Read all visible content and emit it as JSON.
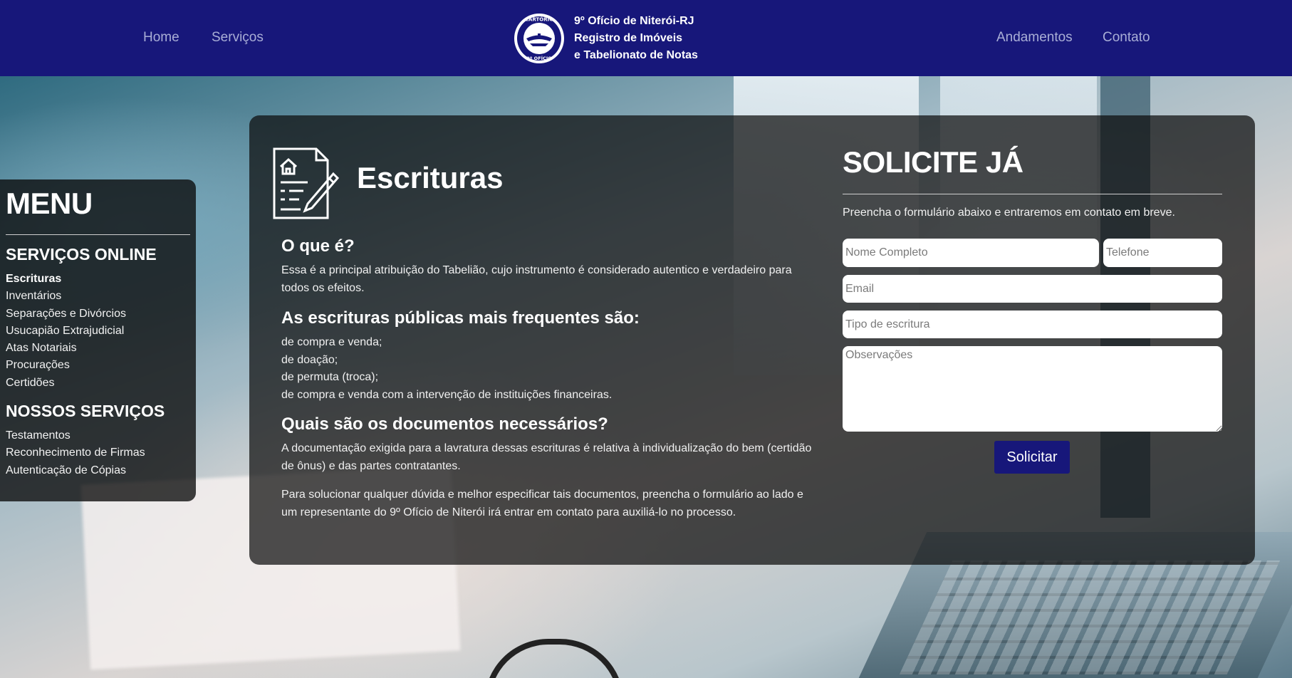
{
  "header": {
    "nav_left": [
      "Home",
      "Serviços"
    ],
    "nav_right": [
      "Andamentos",
      "Contato"
    ],
    "brand_lines": [
      "9º Ofício de Niterói-RJ",
      "Registro de Imóveis",
      "e Tabelionato de Notas"
    ],
    "logo_text_top": "CARTÓRIO",
    "logo_text_bottom": "9º OFÍCIO",
    "bar_color": "#17177a"
  },
  "menu": {
    "title": "MENU",
    "online_heading": "SERVIÇOS ONLINE",
    "online_items": [
      "Escrituras",
      "Inventários",
      "Separações e Divórcios",
      "Usucapião Extrajudicial",
      "Atas Notariais",
      "Procurações",
      "Certidões"
    ],
    "active_item": "Escrituras",
    "ours_heading": "NOSSOS SERVIÇOS",
    "ours_items": [
      "Testamentos",
      "Reconhecimento de Firmas",
      "Autenticação de Cópias"
    ]
  },
  "content": {
    "title": "Escrituras",
    "icon": "document-house-pen-icon",
    "q1": "O que é?",
    "q1_text": [
      "Essa é a principal atribuição do Tabelião, cujo instrumento é considerado autentico e verdadeiro para",
      "todos os efeitos."
    ],
    "q2": "As escrituras públicas mais frequentes são:",
    "q2_list": [
      "de compra e venda;",
      "de doação;",
      "de permuta (troca);",
      "de compra e venda com a intervenção de instituições financeiras."
    ],
    "q3": "Quais são os documentos necessários?",
    "q3_text": [
      "A documentação exigida para a lavratura dessas escrituras é relativa à individualização do bem (certidão",
      "de ônus) e das partes contratantes."
    ],
    "q3_text2": [
      "Para solucionar qualquer dúvida e melhor especificar tais documentos, preencha o formulário ao lado e",
      "um representante do 9º Ofício de Niterói irá entrar em contato para auxiliá-lo no processo."
    ]
  },
  "form": {
    "title": "SOLICITE JÁ",
    "subtitle": "Preencha o formulário abaixo e entraremos em contato em breve.",
    "name_placeholder": "Nome Completo",
    "phone_placeholder": "Telefone",
    "email_placeholder": "Email",
    "type_placeholder": "Tipo de escritura",
    "notes_placeholder": "Observações",
    "submit_label": "Solicitar"
  }
}
